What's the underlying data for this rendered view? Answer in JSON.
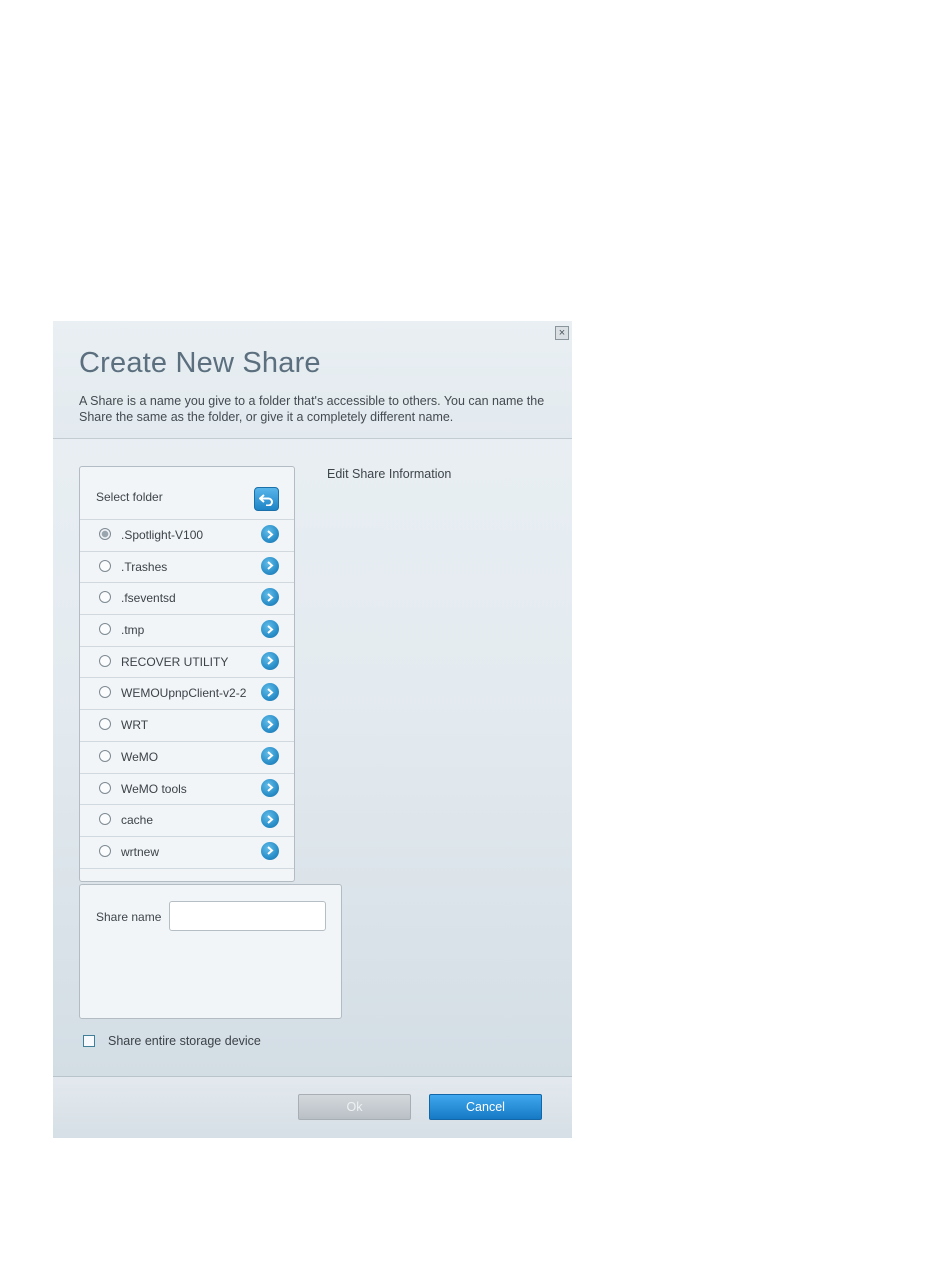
{
  "dialog": {
    "title": "Create New Share",
    "description": "A Share is a name you give to a folder that's accessible to others. You can name the Share the same as the folder, or give it a completely different name.",
    "close_icon": "close-icon"
  },
  "folder_panel": {
    "label": "Select folder",
    "back_icon": "back-arrow-icon",
    "folders": [
      {
        "name": ".Spotlight-V100",
        "selected": true
      },
      {
        "name": ".Trashes",
        "selected": false
      },
      {
        "name": ".fseventsd",
        "selected": false
      },
      {
        "name": ".tmp",
        "selected": false
      },
      {
        "name": "RECOVER UTILITY",
        "selected": false
      },
      {
        "name": "WEMOUpnpClient-v2-2",
        "selected": false
      },
      {
        "name": "WRT",
        "selected": false
      },
      {
        "name": "WeMO",
        "selected": false
      },
      {
        "name": "WeMO tools",
        "selected": false
      },
      {
        "name": "cache",
        "selected": false
      },
      {
        "name": "wrtnew",
        "selected": false
      }
    ]
  },
  "edit_info": {
    "label": "Edit Share Information"
  },
  "share_name": {
    "label": "Share name",
    "value": ""
  },
  "share_entire": {
    "label": "Share entire storage device",
    "checked": false
  },
  "buttons": {
    "ok": "Ok",
    "cancel": "Cancel"
  },
  "colors": {
    "title": "#5b6f7e",
    "accent": "#1e84c6",
    "cancel_button": "#1679c4",
    "ok_button_disabled": "#c4cacf"
  }
}
